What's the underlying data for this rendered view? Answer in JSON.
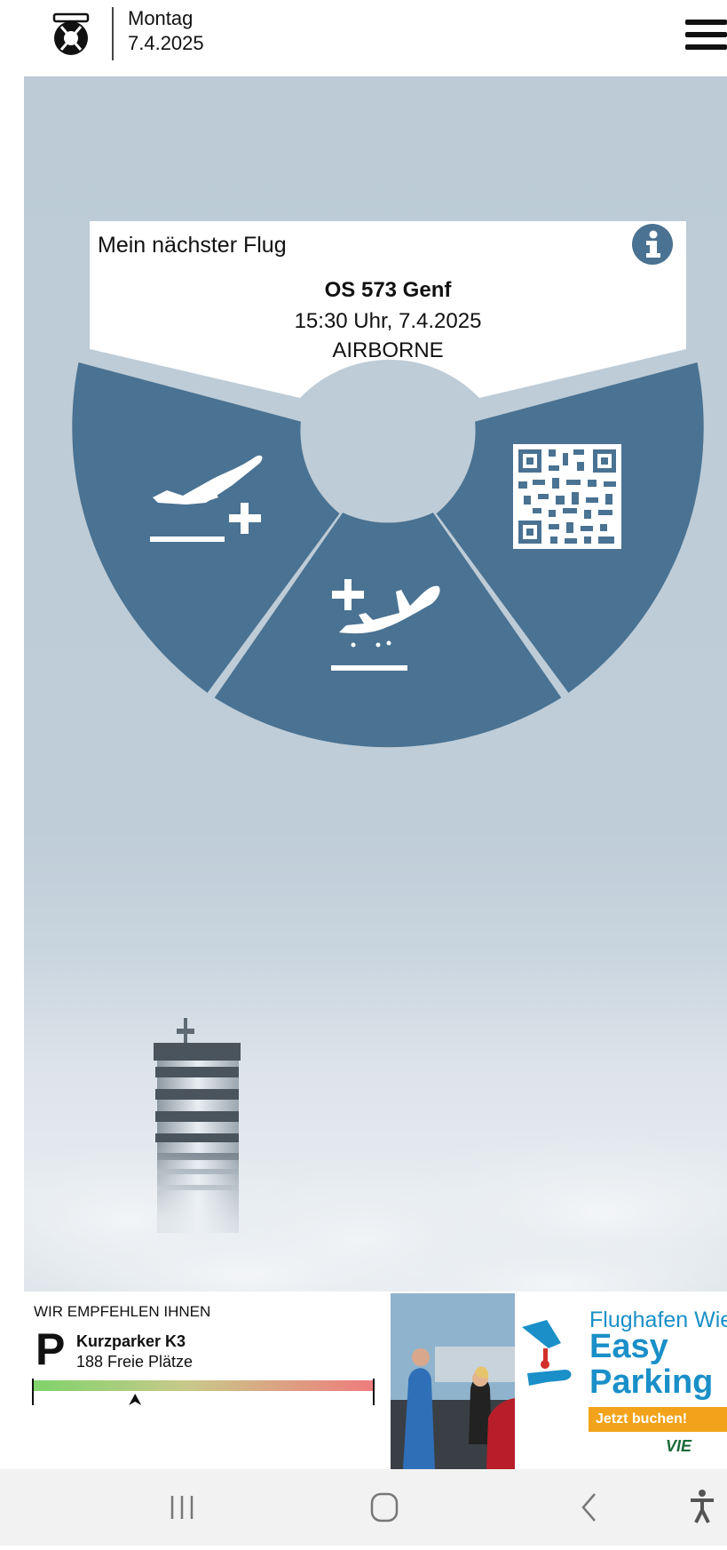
{
  "header": {
    "day": "Montag",
    "date": "7.4.2025"
  },
  "next_flight": {
    "title": "Mein nächster Flug",
    "flight_number": "OS 573 Genf",
    "time": "15:30 Uhr, 7.4.2025",
    "status": "AIRBORNE"
  },
  "wheel": {
    "segments": [
      {
        "name": "departure",
        "icon": "airplane-takeoff-plus-icon"
      },
      {
        "name": "arrival",
        "icon": "airplane-landing-plus-icon"
      },
      {
        "name": "boarding-pass",
        "icon": "qr-code-icon"
      }
    ]
  },
  "recommendation": {
    "title": "WIR EMPFEHLEN IHNEN",
    "parking_symbol": "P",
    "parking_name": "Kurzparker K3",
    "parking_free": "188 Freie Plätze",
    "occupancy_level": 0.3
  },
  "ad": {
    "line1": "Flughafen Wien",
    "line2": "Easy",
    "line3": "Parking",
    "cta": "Jetzt buchen!",
    "brand": "VIE"
  },
  "colors": {
    "segment": "#4a7292",
    "background": "#bccbd6",
    "ad_blue": "#1a8fc8",
    "ad_orange": "#f2a31b"
  }
}
